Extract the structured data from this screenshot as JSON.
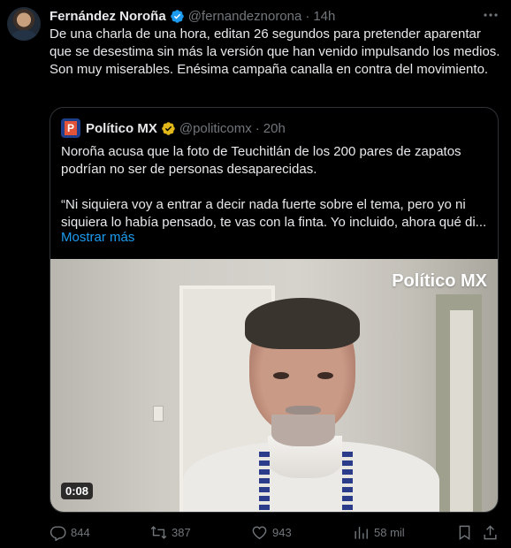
{
  "tweet": {
    "author_name": "Fernández Noroña",
    "handle": "@fernandeznorona",
    "separator": "·",
    "time": "14h",
    "text": "De una charla de una hora, editan 26 segundos para pretender aparentar que se desestima sin más la versión que han venido impulsando los medios. Son muy miserables. Enésima campaña canalla en contra del movimiento."
  },
  "quote": {
    "logo_letter": "P",
    "author_name": "Político MX",
    "handle": "@politicomx",
    "separator": "·",
    "time": "20h",
    "paragraph_1": "Noroña acusa que la foto de Teuchitlán de los 200 pares de zapatos podrían no ser de personas desaparecidas.",
    "paragraph_2": "“Ni siquiera voy a entrar a decir nada fuerte sobre el tema, pero yo ni siquiera lo había pensado, te vas con la finta. Yo incluido, ahora qué di...",
    "show_more": "Mostrar más",
    "video": {
      "watermark": "Político MX",
      "duration": "0:08"
    }
  },
  "actions": {
    "replies": "844",
    "reposts": "387",
    "likes": "943",
    "views": "58 mil"
  },
  "icons": {
    "more": "more-icon",
    "reply": "reply-icon",
    "repost": "repost-icon",
    "like": "heart-icon",
    "views": "views-icon",
    "bookmark": "bookmark-icon",
    "share": "share-icon",
    "verified": "verified-icon"
  },
  "colors": {
    "background": "#000000",
    "text": "#e7e9ea",
    "muted": "#71767b",
    "link": "#1d9bf0",
    "verified_blue": "#1d9bf0",
    "verified_gold": "#e2b719",
    "border": "#2f3336"
  }
}
